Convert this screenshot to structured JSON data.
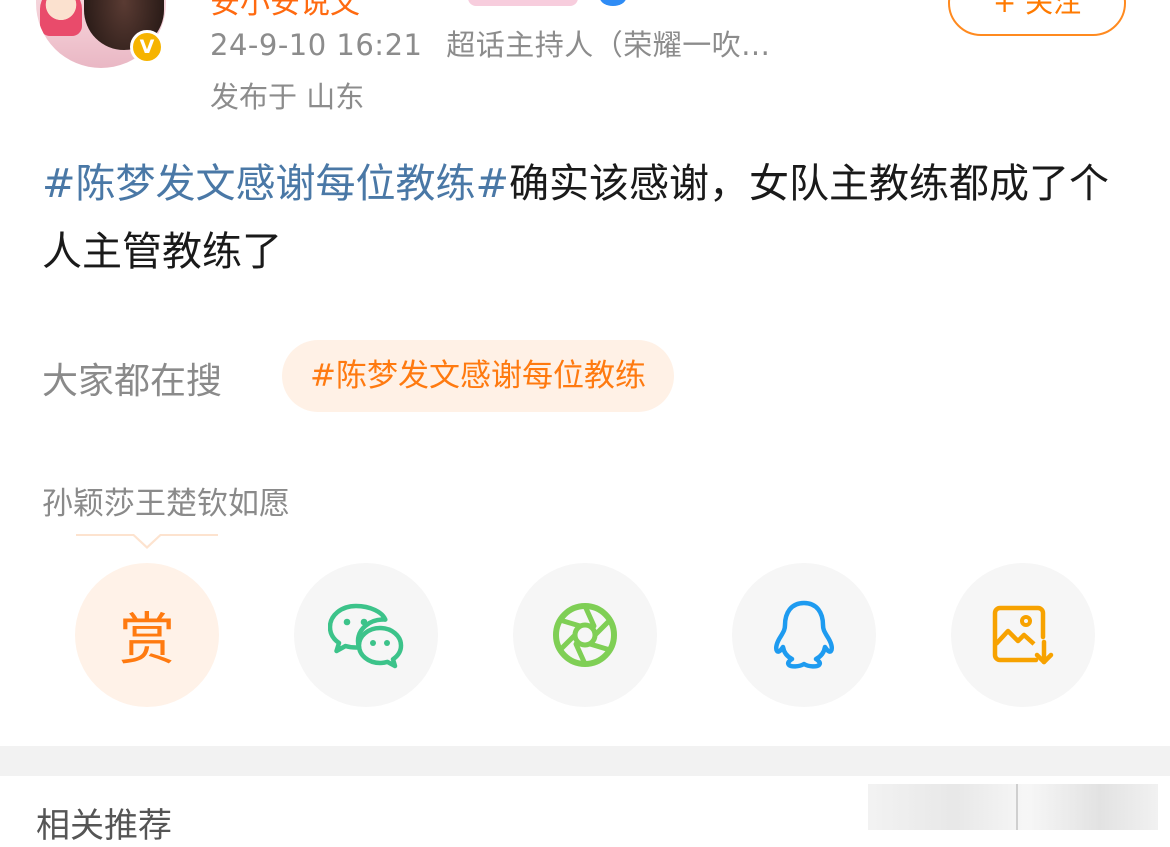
{
  "header": {
    "username": "安小安说文",
    "badge_letter": "V",
    "timestamp": "24-9-10 16:21",
    "role": "超话主持人（荣耀一吹...",
    "location": "发布于 山东",
    "follow_label": "+ 关注"
  },
  "post": {
    "hashtag": "#陈梦发文感谢每位教练#",
    "text": "确实该感谢，女队主教练都成了个人主管教练了"
  },
  "trending": {
    "label": "大家都在搜",
    "chip": "#陈梦发文感谢每位教练"
  },
  "sub_line": "孙颖莎王楚钦如愿",
  "actions": [
    {
      "name": "reward",
      "label": "赏",
      "color": "#ff7a10"
    },
    {
      "name": "wechat",
      "icon": "wechat-icon",
      "color": "#3cc38a"
    },
    {
      "name": "moments",
      "icon": "moments-icon",
      "color": "#7fcf55"
    },
    {
      "name": "qq",
      "icon": "qq-icon",
      "color": "#1e9bf0"
    },
    {
      "name": "save-image",
      "icon": "save-image-icon",
      "color": "#f7a200"
    }
  ],
  "related": {
    "title": "相关推荐"
  }
}
